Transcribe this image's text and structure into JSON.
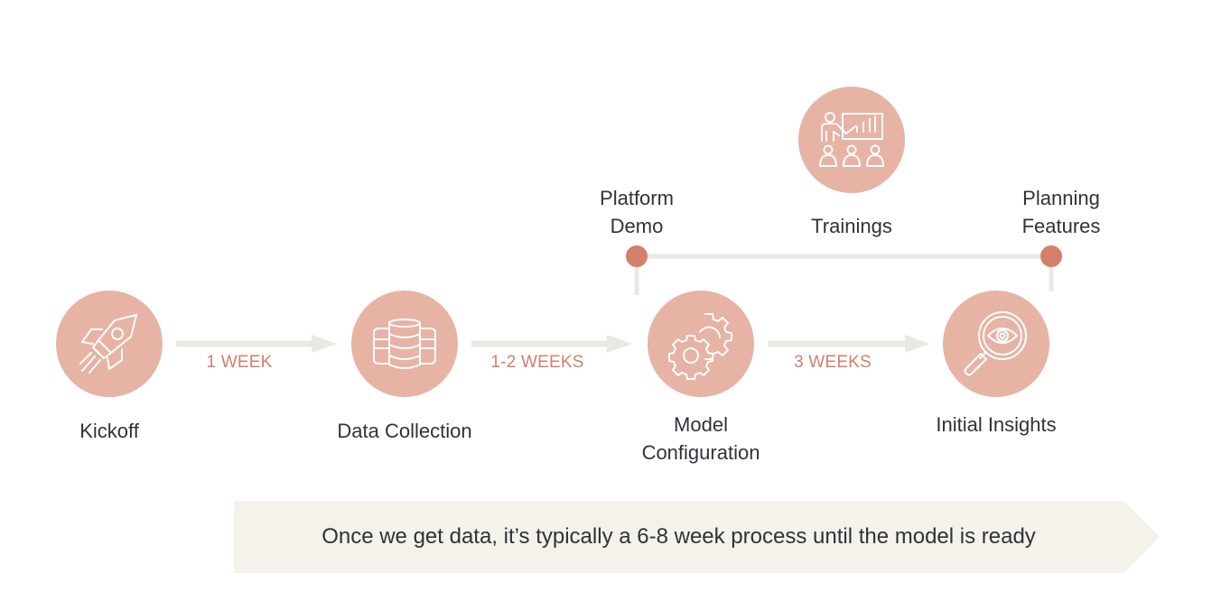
{
  "colors": {
    "circle_fill": "#e6b3a5",
    "icon_stroke": "#ffffff",
    "accent": "#d27f6b",
    "milestone_dot": "#d37f6b",
    "connector": "#e9e8e3",
    "banner_fill": "#f5f2ec",
    "text": "#2e3338"
  },
  "stages": [
    {
      "label": "Kickoff",
      "icon": "rocket-icon"
    },
    {
      "label": "Data Collection",
      "icon": "database-icon"
    },
    {
      "label_line1": "Model",
      "label_line2": "Configuration",
      "icon": "gears-icon"
    },
    {
      "label": "Initial Insights",
      "icon": "magnifier-eye-icon"
    }
  ],
  "durations": [
    "1 WEEK",
    "1-2 WEEKS",
    "3 WEEKS"
  ],
  "milestones": {
    "start": {
      "line1": "Platform",
      "line2": "Demo"
    },
    "middle": {
      "label": "Trainings",
      "icon": "presentation-icon"
    },
    "end": {
      "line1": "Planning",
      "line2": "Features"
    }
  },
  "banner": {
    "text": "Once we get data, it’s typically a 6-8 week process until the model is ready"
  }
}
